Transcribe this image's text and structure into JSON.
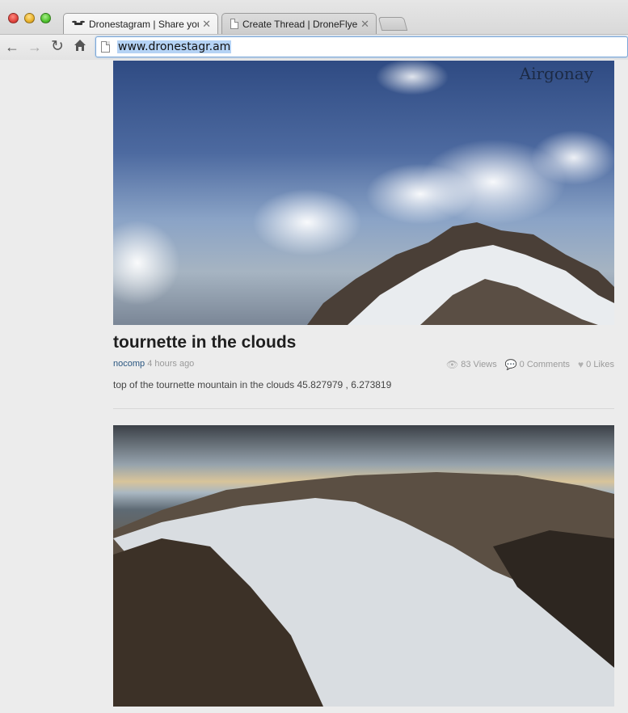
{
  "browser": {
    "tabs": [
      {
        "label": "Dronestagram | Share your"
      },
      {
        "label": "Create Thread | DroneFlyer"
      }
    ],
    "url": "www.dronestagr.am"
  },
  "photo_1": {
    "watermark": "Airgonay"
  },
  "post": {
    "title": "tournette in the clouds",
    "author": "nocomp",
    "time": "4 hours ago",
    "views": "83 Views",
    "comments": "0 Comments",
    "likes": "0 Likes",
    "description": "top of the tournette mountain in the clouds 45.827979 , 6.273819"
  }
}
